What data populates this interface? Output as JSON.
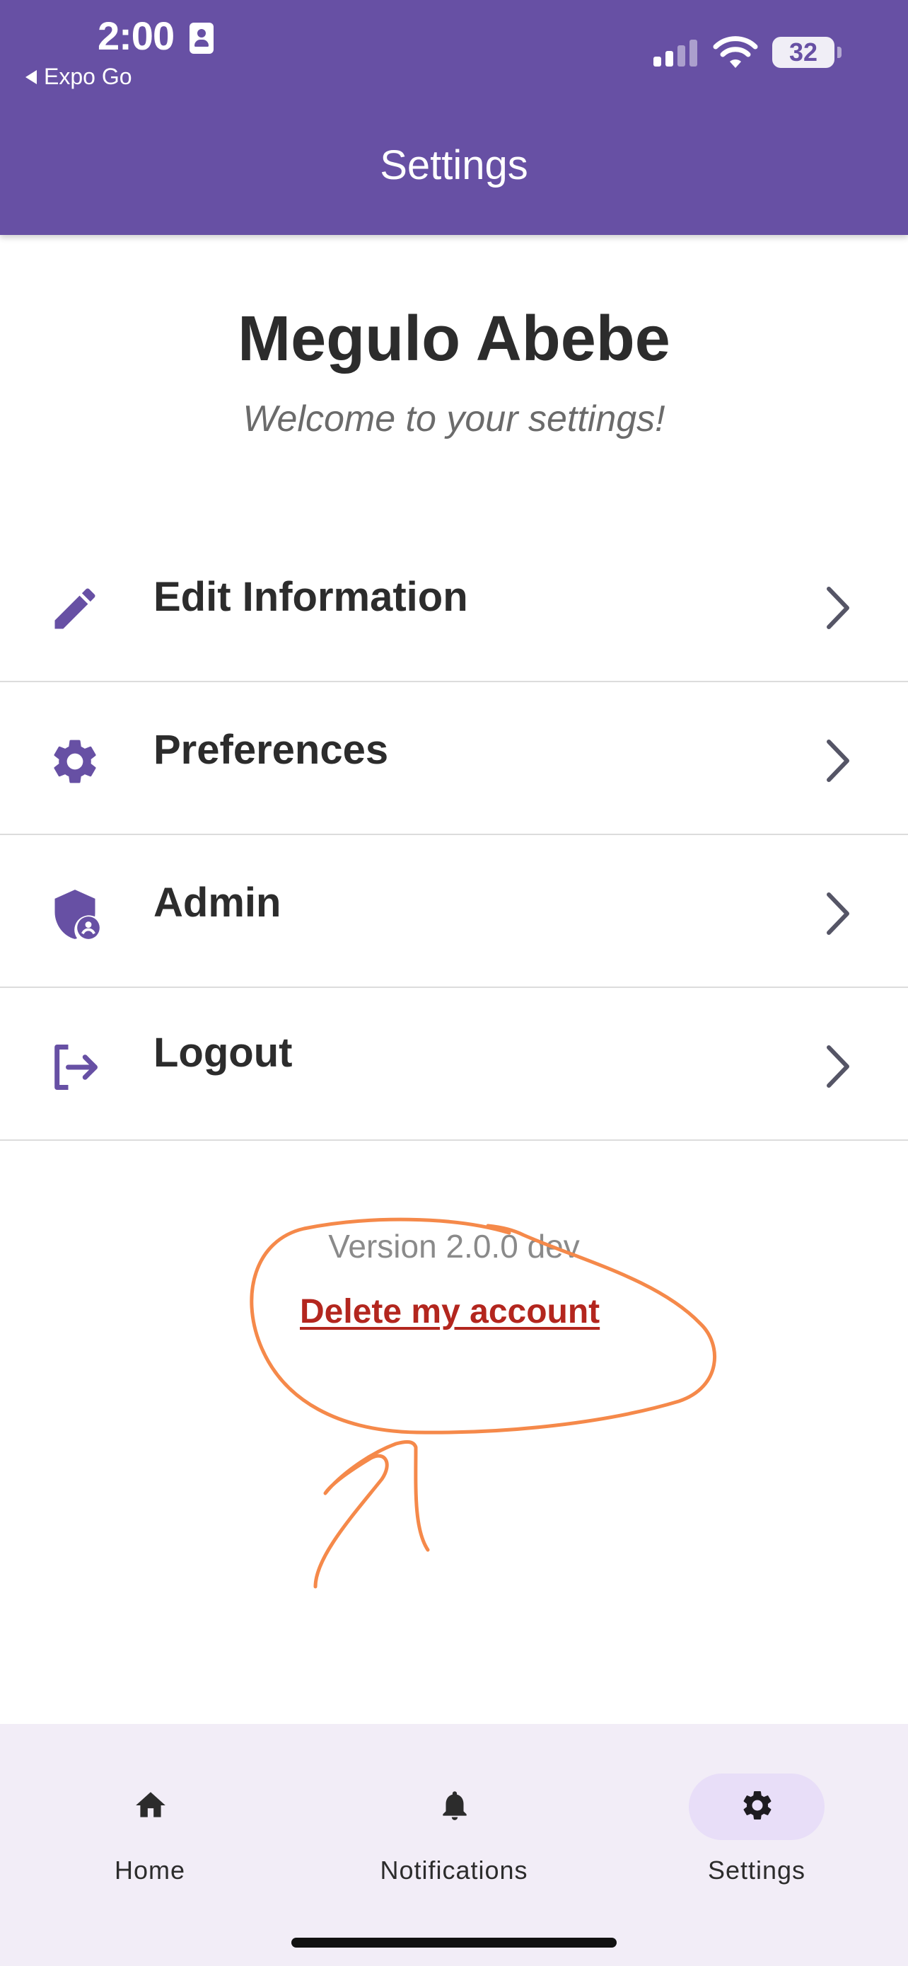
{
  "status_bar": {
    "time": "2:00",
    "back_app": "Expo Go",
    "battery": "32"
  },
  "header": {
    "title": "Settings"
  },
  "profile": {
    "name": "Megulo Abebe",
    "subtitle": "Welcome to your settings!"
  },
  "menu": [
    {
      "label": "Edit Information",
      "icon": "pencil-icon"
    },
    {
      "label": "Preferences",
      "icon": "gear-icon"
    },
    {
      "label": "Admin",
      "icon": "admin-shield-icon"
    },
    {
      "label": "Logout",
      "icon": "logout-icon"
    }
  ],
  "footer": {
    "version": "Version 2.0.0 dev",
    "delete_account": "Delete my account"
  },
  "bottom_nav": {
    "tabs": [
      {
        "label": "Home",
        "icon": "home-icon",
        "active": false
      },
      {
        "label": "Notifications",
        "icon": "bell-icon",
        "active": false
      },
      {
        "label": "Settings",
        "icon": "gear-icon",
        "active": true
      }
    ]
  },
  "colors": {
    "primary": "#6750a4",
    "danger": "#b3261e",
    "annotation": "#f5894a",
    "nav_background": "#f2edf7",
    "nav_active_pill": "#e8def8"
  }
}
